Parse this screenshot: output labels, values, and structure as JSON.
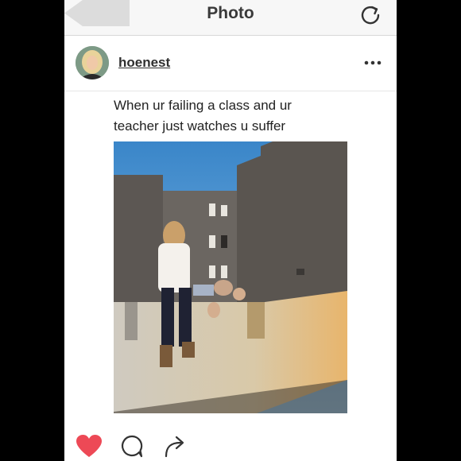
{
  "topbar": {
    "title": "Photo",
    "back_icon": "back-arrow-icon",
    "refresh_icon": "refresh-icon"
  },
  "post": {
    "username": "hoenest",
    "more_icon": "more-options-icon",
    "caption_line1": "When ur failing a class and ur",
    "caption_line2": "teacher just watches u suffer"
  },
  "actions": {
    "like_icon": "heart-icon",
    "comment_icon": "comment-icon",
    "share_icon": "share-icon",
    "like_color": "#ed4956"
  }
}
